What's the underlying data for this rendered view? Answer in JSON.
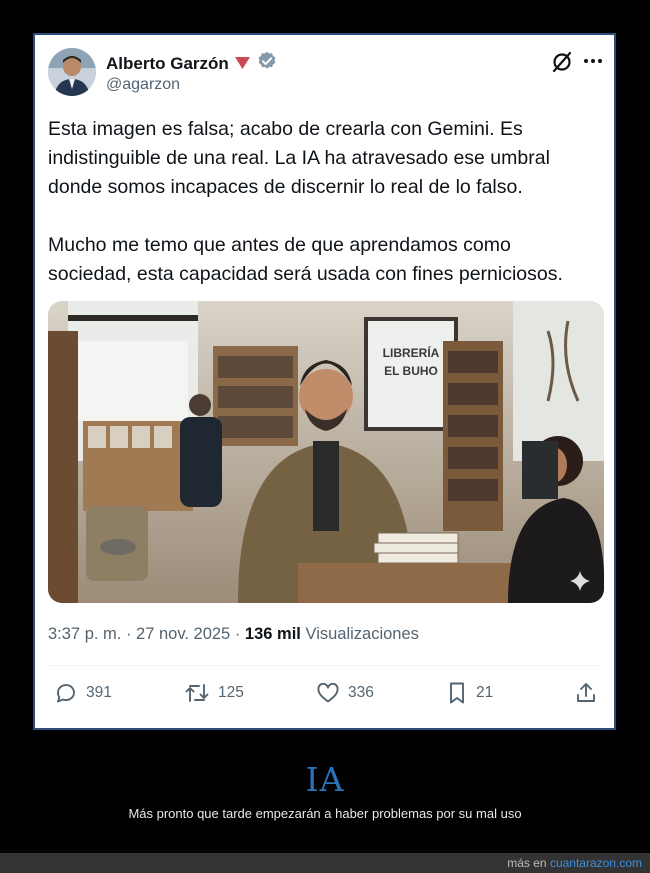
{
  "tweet": {
    "display_name": "Alberto Garzón",
    "handle": "@agarzon",
    "paragraphs": [
      "Esta imagen es falsa; acabo de crearla con Gemini. Es indistinguible de una real. La IA ha atravesado ese umbral donde somos incapaces de discernir lo real de lo falso.",
      "Mucho me temo que antes de que aprendamos como sociedad, esta capacidad será usada con fines perniciosos."
    ],
    "image": {
      "shop_sign_line1": "LIBRERÍA",
      "shop_sign_line2": "EL BUHO"
    },
    "time": "3:37 p. m.",
    "separator": " · ",
    "date": "27 nov. 2025",
    "views_count": "136 mil",
    "views_label": "Visualizaciones",
    "actions": {
      "replies": "391",
      "reposts": "125",
      "likes": "336",
      "bookmarks": "21"
    }
  },
  "footer": {
    "title": "IA",
    "caption": "Más pronto que tarde empezarán a haber problemas por su mal uso",
    "more_prefix": "más en ",
    "site": "cuantarazon.com"
  },
  "colors": {
    "card_border": "#2d4e79",
    "verified": "#829aab",
    "title_blue": "#2b73b8",
    "link_blue": "#3d8de0",
    "muted": "#536471"
  },
  "icons": [
    "verified-badge-icon",
    "red-triangle-flag-icon",
    "grok-icon",
    "more-icon",
    "reply-icon",
    "repost-icon",
    "like-icon",
    "bookmark-icon",
    "share-icon",
    "sparkle-watermark-icon"
  ]
}
